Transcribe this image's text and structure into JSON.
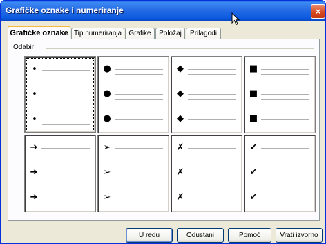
{
  "window": {
    "title": "Grafičke oznake i numeriranje",
    "close_icon": "×"
  },
  "tabs": [
    {
      "label": "Grafičke oznake",
      "active": true
    },
    {
      "label": "Tip numeriranja",
      "active": false
    },
    {
      "label": "Grafike",
      "active": false
    },
    {
      "label": "Položaj",
      "active": false
    },
    {
      "label": "Prilagodi",
      "active": false
    }
  ],
  "group": {
    "label": "Odabir"
  },
  "presets": [
    {
      "symbol": "•",
      "icon": "small-bullet-icon",
      "selected": true
    },
    {
      "symbol": "●",
      "icon": "large-bullet-icon",
      "selected": false
    },
    {
      "symbol": "◆",
      "icon": "diamond-bullet-icon",
      "selected": false
    },
    {
      "symbol": "■",
      "icon": "square-bullet-icon",
      "selected": false
    },
    {
      "symbol": "➔",
      "icon": "arrow-bullet-icon",
      "selected": false
    },
    {
      "symbol": "➢",
      "icon": "arrowhead-bullet-icon",
      "selected": false
    },
    {
      "symbol": "✗",
      "icon": "cross-bullet-icon",
      "selected": false
    },
    {
      "symbol": "✔",
      "icon": "checkmark-bullet-icon",
      "selected": false
    }
  ],
  "buttons": {
    "ok": "U redu",
    "cancel": "Odustani",
    "help": "Pomoć",
    "reset": "Vrati izvorno"
  }
}
